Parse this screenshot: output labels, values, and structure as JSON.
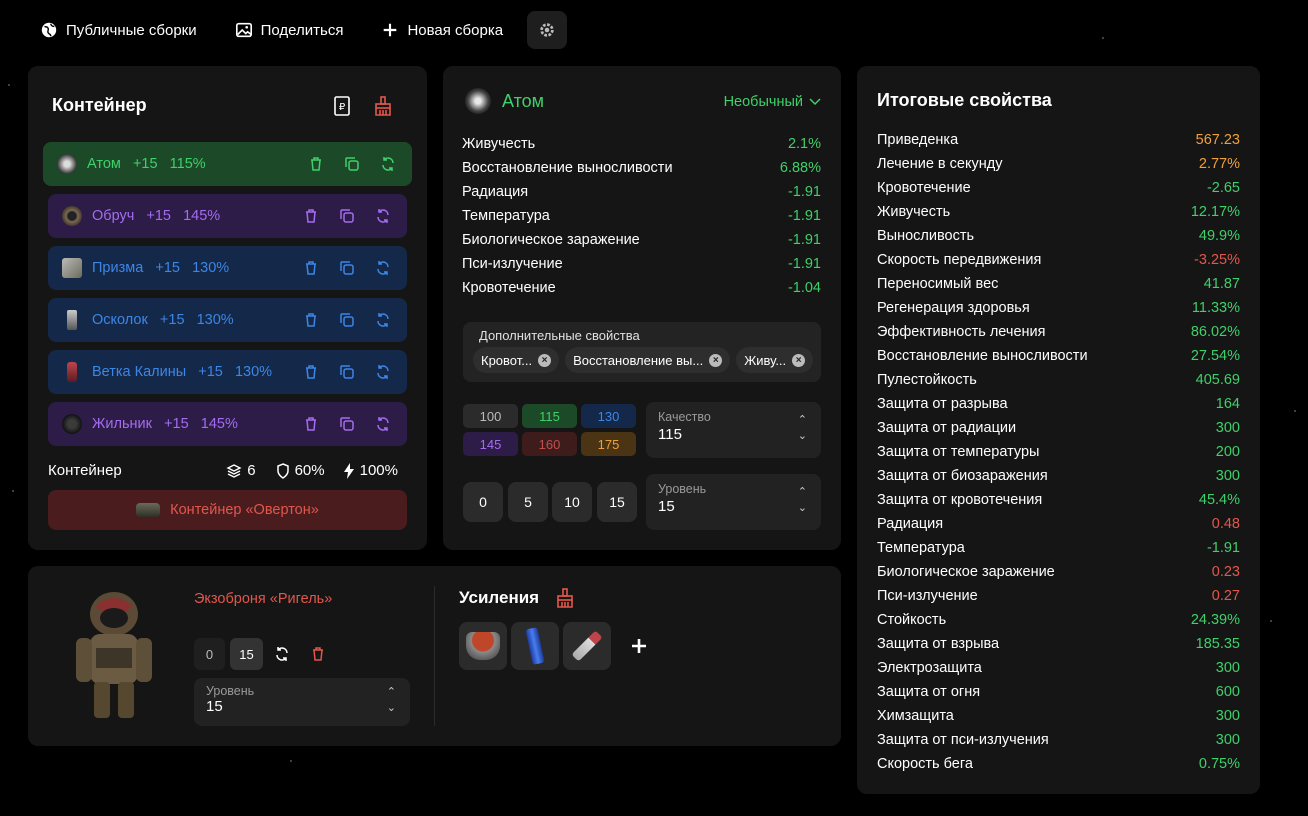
{
  "topbar": {
    "public_builds": "Публичные сборки",
    "share": "Поделиться",
    "new_build": "Новая сборка"
  },
  "container": {
    "title": "Контейнер",
    "items": [
      {
        "name": "Атом",
        "level": "+15",
        "quality": "115%",
        "tier": "green"
      },
      {
        "name": "Обруч",
        "level": "+15",
        "quality": "145%",
        "tier": "purple"
      },
      {
        "name": "Призма",
        "level": "+15",
        "quality": "130%",
        "tier": "blue"
      },
      {
        "name": "Осколок",
        "level": "+15",
        "quality": "130%",
        "tier": "blue"
      },
      {
        "name": "Ветка Калины",
        "level": "+15",
        "quality": "130%",
        "tier": "blue"
      },
      {
        "name": "Жильник",
        "level": "+15",
        "quality": "145%",
        "tier": "purple"
      }
    ],
    "footer_label": "Контейнер",
    "slots": "6",
    "protection": "60%",
    "efficiency": "100%",
    "container_name": "Контейнер «Овертон»"
  },
  "artifact": {
    "name": "Атом",
    "rarity": "Необычный",
    "stats": [
      {
        "label": "Живучесть",
        "value": "2.1%"
      },
      {
        "label": "Восстановление выносливости",
        "value": "6.88%"
      },
      {
        "label": "Радиация",
        "value": "-1.91"
      },
      {
        "label": "Температура",
        "value": "-1.91"
      },
      {
        "label": "Биологическое заражение",
        "value": "-1.91"
      },
      {
        "label": "Пси-излучение",
        "value": "-1.91"
      },
      {
        "label": "Кровотечение",
        "value": "-1.04"
      }
    ],
    "extra_title": "Дополнительные свойства",
    "extra_chips": [
      "Кровот...",
      "Восстановление вы...",
      "Живу..."
    ],
    "quality_options": [
      "100",
      "115",
      "130",
      "145",
      "160",
      "175"
    ],
    "quality_label": "Качество",
    "quality_value": "115",
    "level_buttons": [
      "0",
      "5",
      "10",
      "15"
    ],
    "level_label": "Уровень",
    "level_value": "15"
  },
  "armor": {
    "name": "Экзоброня «Ригель»",
    "level_buttons": [
      "0",
      "15"
    ],
    "level_label": "Уровень",
    "level_value": "15",
    "boosts_title": "Усиления"
  },
  "totals": {
    "title": "Итоговые свойства",
    "stats": [
      {
        "label": "Приведенка",
        "value": "567.23",
        "color": "orange"
      },
      {
        "label": "Лечение в секунду",
        "value": "2.77%",
        "color": "orange"
      },
      {
        "label": "Кровотечение",
        "value": "-2.65",
        "color": "green"
      },
      {
        "label": "Живучесть",
        "value": "12.17%",
        "color": "green"
      },
      {
        "label": "Выносливость",
        "value": "49.9%",
        "color": "green"
      },
      {
        "label": "Скорость передвижения",
        "value": "-3.25%",
        "color": "red"
      },
      {
        "label": "Переносимый вес",
        "value": "41.87",
        "color": "green"
      },
      {
        "label": "Регенерация здоровья",
        "value": "11.33%",
        "color": "green"
      },
      {
        "label": "Эффективность лечения",
        "value": "86.02%",
        "color": "green"
      },
      {
        "label": "Восстановление выносливости",
        "value": "27.54%",
        "color": "green"
      },
      {
        "label": "Пулестойкость",
        "value": "405.69",
        "color": "green"
      },
      {
        "label": "Защита от разрыва",
        "value": "164",
        "color": "green"
      },
      {
        "label": "Защита от радиации",
        "value": "300",
        "color": "green"
      },
      {
        "label": "Защита от температуры",
        "value": "200",
        "color": "green"
      },
      {
        "label": "Защита от биозаражения",
        "value": "300",
        "color": "green"
      },
      {
        "label": "Защита от кровотечения",
        "value": "45.4%",
        "color": "green"
      },
      {
        "label": "Радиация",
        "value": "0.48",
        "color": "red"
      },
      {
        "label": "Температура",
        "value": "-1.91",
        "color": "green"
      },
      {
        "label": "Биологическое заражение",
        "value": "0.23",
        "color": "red"
      },
      {
        "label": "Пси-излучение",
        "value": "0.27",
        "color": "red"
      },
      {
        "label": "Стойкость",
        "value": "24.39%",
        "color": "green"
      },
      {
        "label": "Защита от взрыва",
        "value": "185.35",
        "color": "green"
      },
      {
        "label": "Электрозащита",
        "value": "300",
        "color": "green"
      },
      {
        "label": "Защита от огня",
        "value": "600",
        "color": "green"
      },
      {
        "label": "Химзащита",
        "value": "300",
        "color": "green"
      },
      {
        "label": "Защита от пси-излучения",
        "value": "300",
        "color": "green"
      },
      {
        "label": "Скорость бега",
        "value": "0.75%",
        "color": "green"
      }
    ]
  },
  "colors": {
    "green": "#3fd06a",
    "orange": "#f0a03a",
    "red": "#e2574c",
    "purple": "#a46cf0",
    "blue": "#3c86e6"
  }
}
